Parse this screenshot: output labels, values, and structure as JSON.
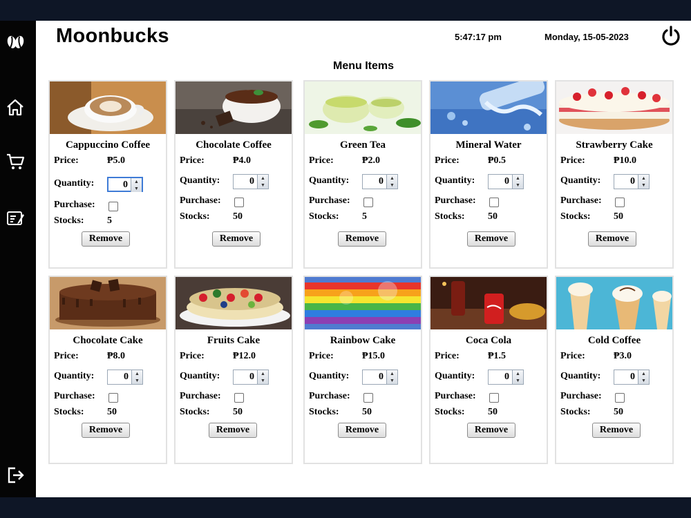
{
  "app": {
    "title": "Moonbucks",
    "time": "5:47:17 pm",
    "date": "Monday, 15-05-2023"
  },
  "sidebar": {
    "items": [
      {
        "icon": "coffee-beans-icon"
      },
      {
        "icon": "home-icon"
      },
      {
        "icon": "cart-icon"
      },
      {
        "icon": "orders-icon"
      },
      {
        "icon": "logout-icon"
      }
    ]
  },
  "labels": {
    "price": "Price:",
    "quantity": "Quantity:",
    "purchase": "Purchase:",
    "stocks": "Stocks:",
    "remove": "Remove"
  },
  "menu": {
    "title": "Menu Items",
    "items": [
      {
        "name": "Cappuccino Coffee",
        "price": "₱5.0",
        "quantity": "0",
        "purchase": false,
        "stocks": "5"
      },
      {
        "name": "Chocolate Coffee",
        "price": "₱4.0",
        "quantity": "0",
        "purchase": false,
        "stocks": "50"
      },
      {
        "name": "Green Tea",
        "price": "₱2.0",
        "quantity": "0",
        "purchase": false,
        "stocks": "5"
      },
      {
        "name": "Mineral Water",
        "price": "₱0.5",
        "quantity": "0",
        "purchase": false,
        "stocks": "50"
      },
      {
        "name": "Strawberry Cake",
        "price": "₱10.0",
        "quantity": "0",
        "purchase": false,
        "stocks": "50"
      },
      {
        "name": "Chocolate Cake",
        "price": "₱8.0",
        "quantity": "0",
        "purchase": false,
        "stocks": "50"
      },
      {
        "name": "Fruits Cake",
        "price": "₱12.0",
        "quantity": "0",
        "purchase": false,
        "stocks": "50"
      },
      {
        "name": "Rainbow Cake",
        "price": "₱15.0",
        "quantity": "0",
        "purchase": false,
        "stocks": "50"
      },
      {
        "name": "Coca Cola",
        "price": "₱1.5",
        "quantity": "0",
        "purchase": false,
        "stocks": "50"
      },
      {
        "name": "Cold Coffee",
        "price": "₱3.0",
        "quantity": "0",
        "purchase": false,
        "stocks": "50"
      }
    ]
  }
}
